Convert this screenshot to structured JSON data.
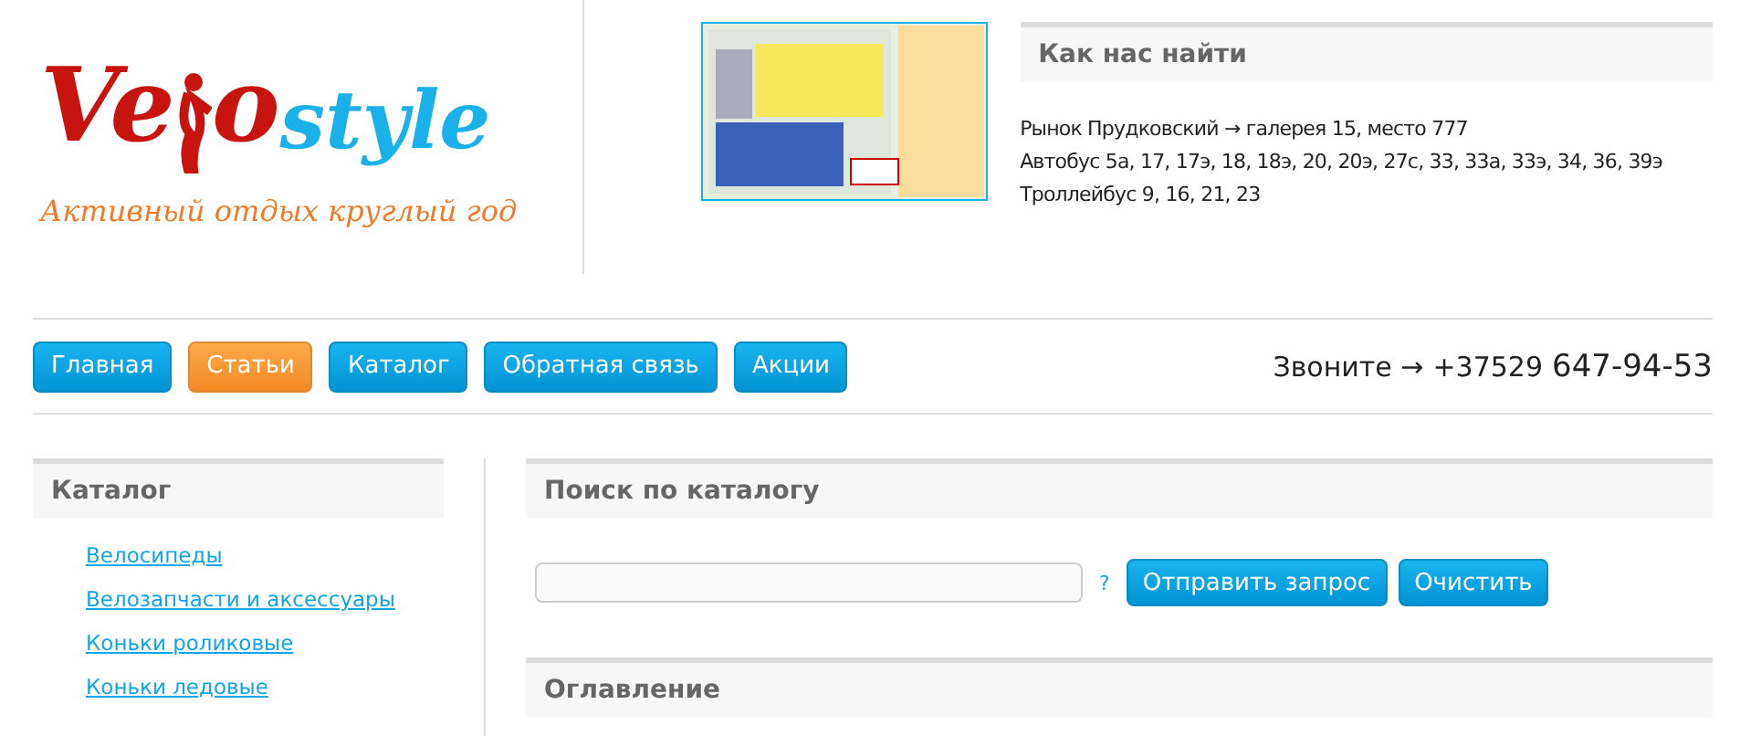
{
  "logo": {
    "part1": "Ve",
    "part2": "o",
    "part3": "style",
    "tagline": "Активный отдых круглый год"
  },
  "location": {
    "title": "Как нас найти",
    "lines": [
      "Рынок Прудковский → галерея 15, место 777",
      "Автобус 5а, 17, 17э, 18, 18э, 20, 20э, 27с, 33, 33а, 33э, 34, 36, 39э",
      "Троллейбус 9, 16, 21, 23"
    ]
  },
  "nav": [
    {
      "label": "Главная",
      "selected": false
    },
    {
      "label": "Статьи",
      "selected": true
    },
    {
      "label": "Каталог",
      "selected": false
    },
    {
      "label": "Обратная связь",
      "selected": false
    },
    {
      "label": "Акции",
      "selected": false
    }
  ],
  "phone": {
    "label": "Звоните →",
    "code": "+37529",
    "number": "647-94-53"
  },
  "sidebar": {
    "title": "Каталог",
    "items": [
      "Велосипеды",
      "Велозапчасти и аксессуары",
      "Коньки роликовые",
      "Коньки ледовые"
    ]
  },
  "search": {
    "title": "Поиск по каталогу",
    "help": "?",
    "buttons": [
      "Отправить запрос",
      "Очистить"
    ]
  },
  "contents": {
    "title": "Оглавление"
  }
}
